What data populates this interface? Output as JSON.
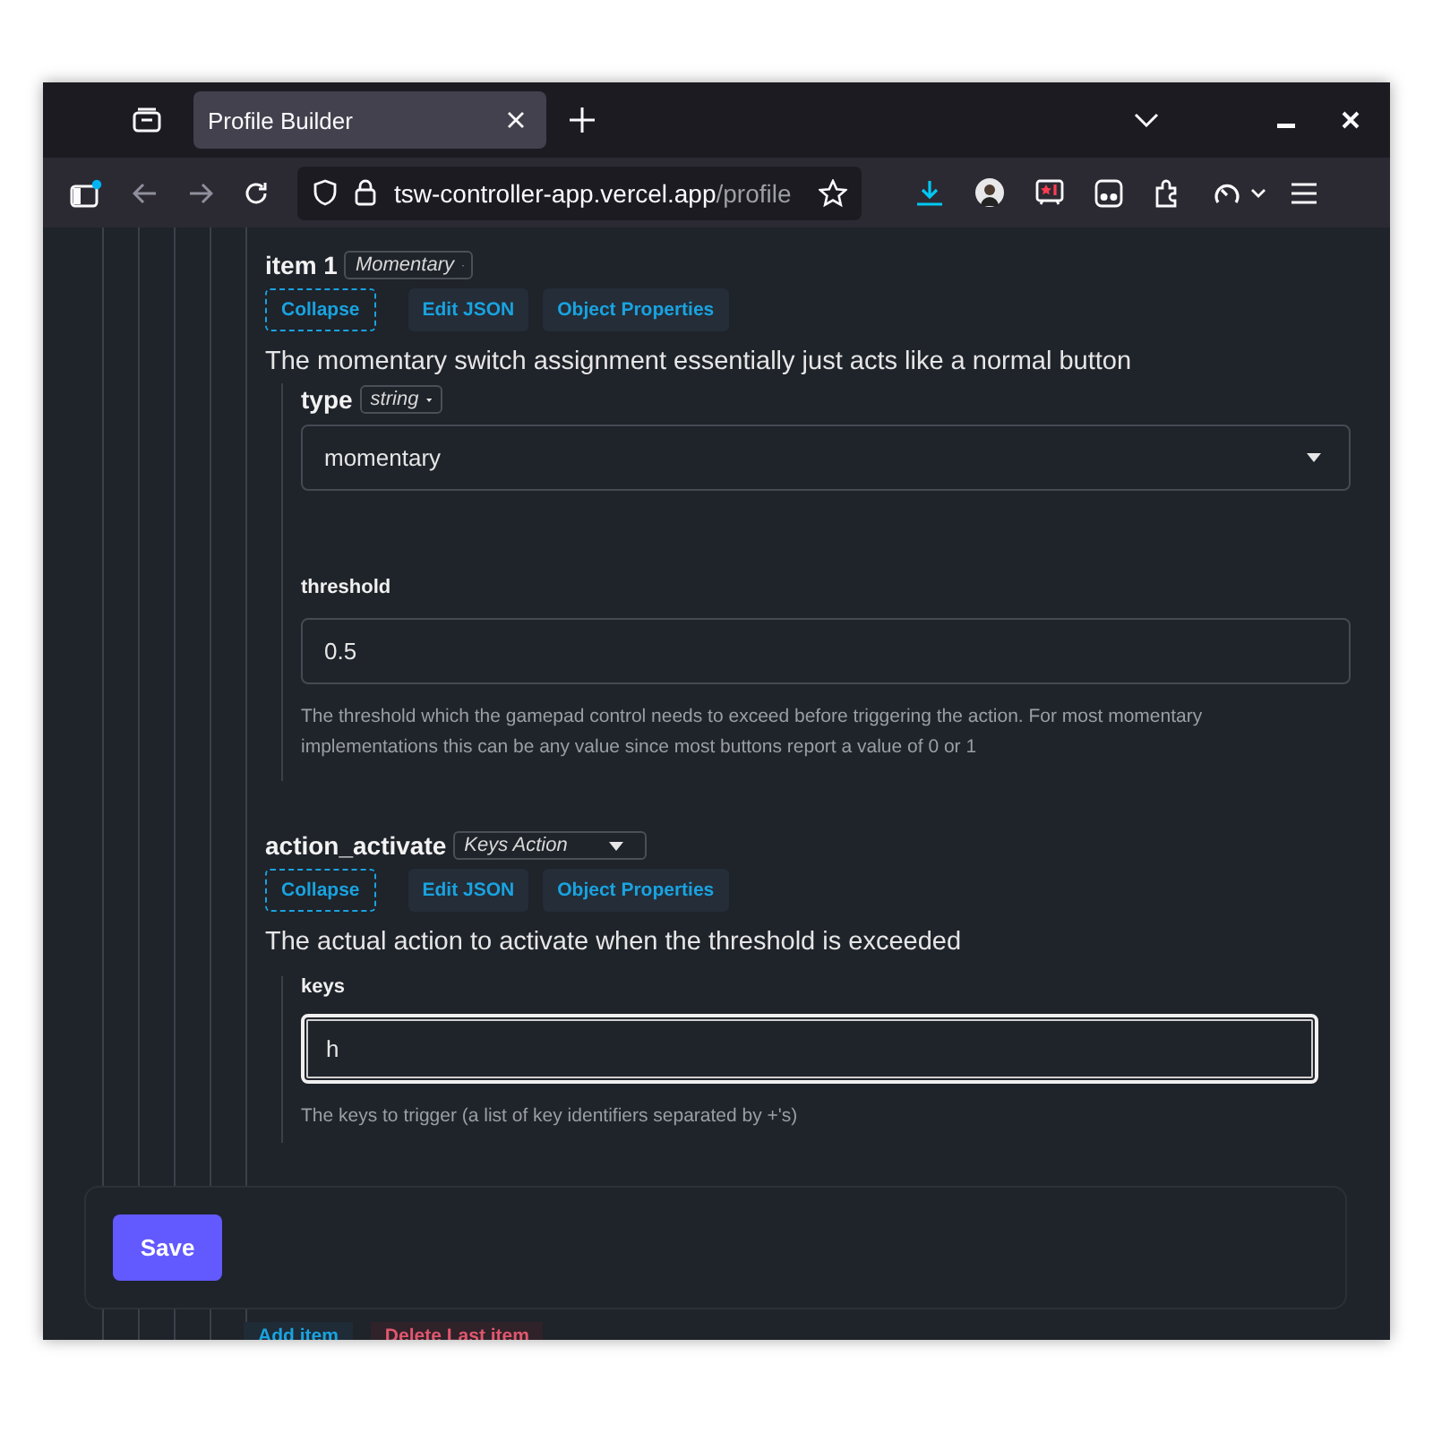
{
  "browser": {
    "tab_title": "Profile Builder",
    "url_host": "tsw-controller-app.vercel.app",
    "url_path": "/profile"
  },
  "item": {
    "title": "item 1",
    "type_select": "Momentary",
    "buttons": [
      {
        "label": "Collapse",
        "kind": "dashed"
      },
      {
        "label": "Edit JSON",
        "kind": "plain"
      },
      {
        "label": "Object Properties",
        "kind": "plain"
      }
    ],
    "description": "The momentary switch assignment essentially just acts like a normal button"
  },
  "type_field": {
    "label": "type",
    "type_select": "string",
    "value": "momentary"
  },
  "threshold": {
    "label": "threshold",
    "value": "0.5",
    "help": "The threshold which the gamepad control needs to exceed before triggering the action. For most momentary implementations this can be any value since most buttons report a value of 0 or 1"
  },
  "action_activate": {
    "title": "action_activate",
    "type_select": "Keys Action",
    "buttons": [
      {
        "label": "Collapse",
        "kind": "dashed"
      },
      {
        "label": "Edit JSON",
        "kind": "plain"
      },
      {
        "label": "Object Properties",
        "kind": "plain"
      }
    ],
    "description": "The actual action to activate when the threshold is exceeded",
    "keys": {
      "label": "keys",
      "value": "h",
      "focused": true,
      "help": "The keys to trigger (a list of key identifiers separated by +'s)"
    }
  },
  "save_button": "Save",
  "array_buttons": [
    {
      "label": "Add item",
      "kind": "add"
    },
    {
      "label": "Delete Last item",
      "kind": "delete"
    }
  ]
}
